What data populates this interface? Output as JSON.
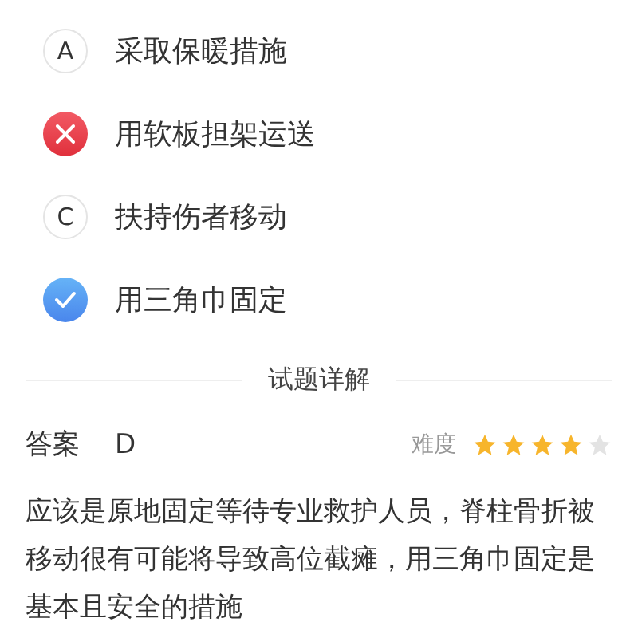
{
  "options": [
    {
      "letter": "A",
      "text": "采取保暖措施",
      "kind": "letter"
    },
    {
      "text": "用软板担架运送",
      "kind": "wrong"
    },
    {
      "letter": "C",
      "text": "扶持伤者移动",
      "kind": "letter"
    },
    {
      "text": "用三角巾固定",
      "kind": "correct"
    }
  ],
  "section_title": "试题详解",
  "answer": {
    "label": "答案",
    "value": "D"
  },
  "difficulty": {
    "label": "难度",
    "stars": 4
  },
  "explanation": "应该是原地固定等待专业救护人员，脊柱骨折被移动很有可能将导致高位截瘫，用三角巾固定是基本且安全的措施"
}
